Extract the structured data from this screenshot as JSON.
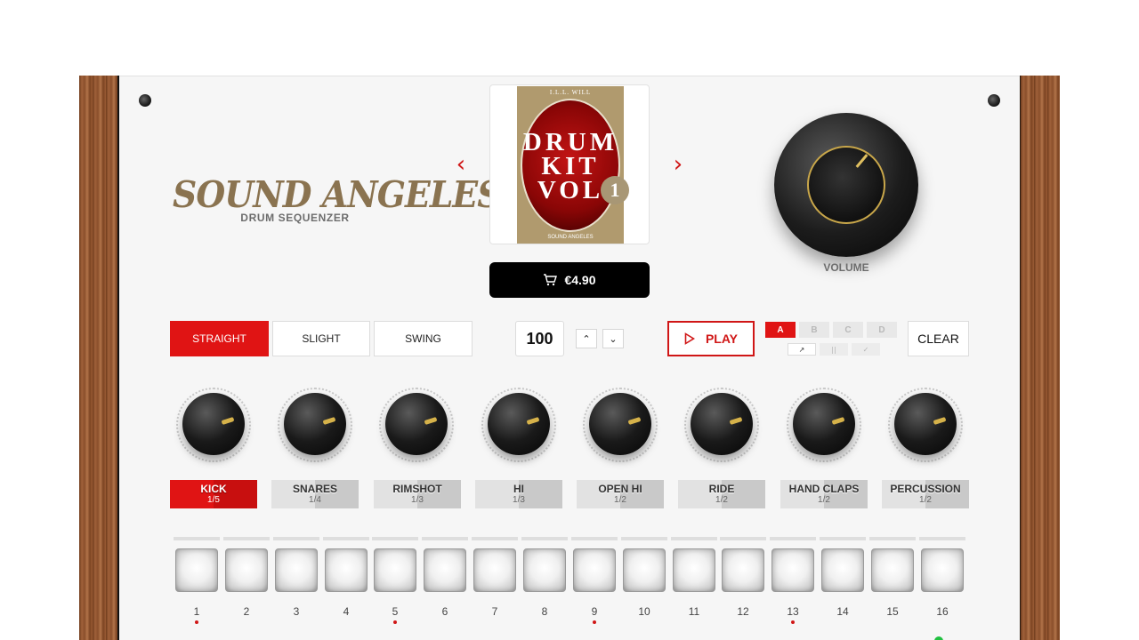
{
  "brand": {
    "logo_text": "SOUND ANGELES",
    "subtitle": "DRUM SEQUENZER"
  },
  "album": {
    "artist": "I.L.L. WILL",
    "title": "DRUM KIT VOL",
    "badge": "1",
    "label": "SOUND ANGELES",
    "price": "€4.90",
    "prev_icon": "chevron-left-icon",
    "next_icon": "chevron-right-icon"
  },
  "volume": {
    "label": "VOLUME"
  },
  "swing": {
    "options": [
      "STRAIGHT",
      "SLIGHT",
      "SWING"
    ],
    "selected": "STRAIGHT"
  },
  "tempo": {
    "bpm": "100",
    "up_glyph": "⌃",
    "down_glyph": "⌄"
  },
  "transport": {
    "play_label": "PLAY"
  },
  "patterns": {
    "slots": [
      "A",
      "B",
      "C",
      "D"
    ],
    "selected": "A",
    "tools": [
      "↗",
      "||",
      "✓"
    ]
  },
  "clear_label": "CLEAR",
  "channels": [
    {
      "name": "KICK",
      "sample": "1/5",
      "active": true
    },
    {
      "name": "SNARES",
      "sample": "1/4",
      "active": false
    },
    {
      "name": "RIMSHOT",
      "sample": "1/3",
      "active": false
    },
    {
      "name": "HI",
      "sample": "1/3",
      "active": false
    },
    {
      "name": "OPEN HI",
      "sample": "1/2",
      "active": false
    },
    {
      "name": "RIDE",
      "sample": "1/2",
      "active": false
    },
    {
      "name": "HAND CLAPS",
      "sample": "1/2",
      "active": false
    },
    {
      "name": "PERCUSSION",
      "sample": "1/2",
      "active": false
    }
  ],
  "steps": {
    "numbers": [
      "1",
      "2",
      "3",
      "4",
      "5",
      "6",
      "7",
      "8",
      "9",
      "10",
      "11",
      "12",
      "13",
      "14",
      "15",
      "16"
    ],
    "marked": [
      1,
      5,
      9,
      13
    ]
  },
  "colors": {
    "accent": "#e01414",
    "brand": "#8a7350",
    "knob_pointer": "#d6b24a"
  }
}
